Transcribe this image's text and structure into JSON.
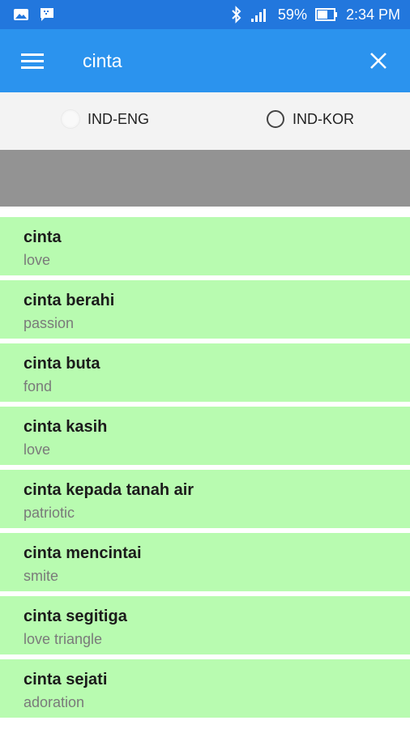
{
  "status_bar": {
    "battery": "59%",
    "time": "2:34 PM",
    "icons": [
      "gallery-icon",
      "chat-icon",
      "bluetooth-icon",
      "signal-icon",
      "battery-icon"
    ]
  },
  "toolbar": {
    "search_value": "cinta",
    "icons": [
      "menu-icon",
      "close-icon"
    ]
  },
  "dictionary_options": [
    {
      "label": "IND-ENG",
      "selected": true
    },
    {
      "label": "IND-KOR",
      "selected": false
    }
  ],
  "results": [
    {
      "word": "cinta",
      "meaning": "love"
    },
    {
      "word": "cinta berahi",
      "meaning": "passion"
    },
    {
      "word": "cinta buta",
      "meaning": "fond"
    },
    {
      "word": "cinta kasih",
      "meaning": "love"
    },
    {
      "word": "cinta kepada tanah air",
      "meaning": "patriotic"
    },
    {
      "word": "cinta mencintai",
      "meaning": "smite"
    },
    {
      "word": "cinta segitiga",
      "meaning": "love triangle"
    },
    {
      "word": "cinta sejati",
      "meaning": "adoration"
    }
  ],
  "colors": {
    "status_bar": "#2277dd",
    "app_bar": "#2b93ee",
    "radio_bar": "#f3f3f3",
    "gray_band": "#939393",
    "result_item": "#b8fbb0"
  }
}
